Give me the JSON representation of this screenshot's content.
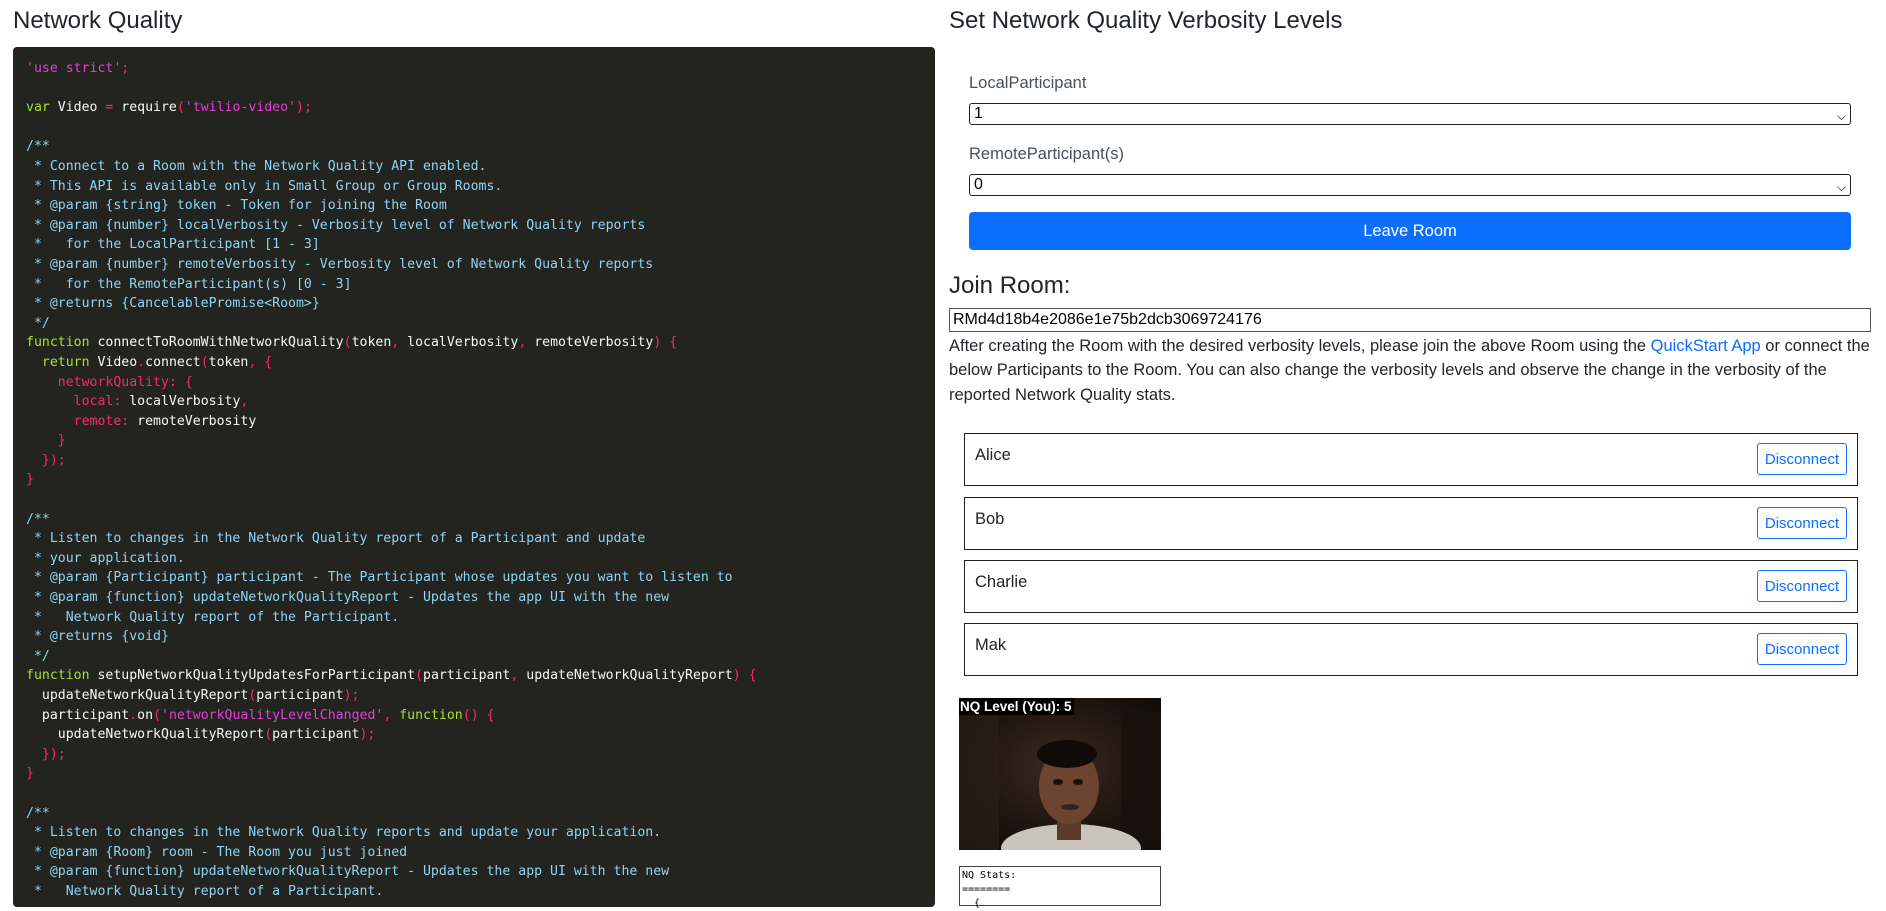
{
  "left": {
    "title": "Network Quality"
  },
  "code": {
    "lines": [
      [
        [
          "s",
          "'use strict'"
        ],
        [
          "p",
          ";"
        ]
      ],
      [],
      [
        [
          "k",
          "var"
        ],
        [
          "t",
          " Video "
        ],
        [
          "p",
          "="
        ],
        [
          "t",
          " require"
        ],
        [
          "p",
          "("
        ],
        [
          "s",
          "'twilio-video'"
        ],
        [
          "p",
          ");"
        ]
      ],
      [],
      [
        [
          "c",
          "/**"
        ]
      ],
      [
        [
          "c",
          " * Connect to a Room with the Network Quality API enabled."
        ]
      ],
      [
        [
          "c",
          " * This API is available only in Small Group or Group Rooms."
        ]
      ],
      [
        [
          "c",
          " * @param {string} token - Token for joining the Room"
        ]
      ],
      [
        [
          "c",
          " * @param {number} localVerbosity - Verbosity level of Network Quality reports"
        ]
      ],
      [
        [
          "c",
          " *   for the LocalParticipant [1 - 3]"
        ]
      ],
      [
        [
          "c",
          " * @param {number} remoteVerbosity - Verbosity level of Network Quality reports"
        ]
      ],
      [
        [
          "c",
          " *   for the RemoteParticipant(s) [0 - 3]"
        ]
      ],
      [
        [
          "c",
          " * @returns {CancelablePromise<Room>}"
        ]
      ],
      [
        [
          "c",
          " */"
        ]
      ],
      [
        [
          "k",
          "function"
        ],
        [
          "t",
          " connectToRoomWithNetworkQuality"
        ],
        [
          "p",
          "("
        ],
        [
          "t",
          "token"
        ],
        [
          "p",
          ","
        ],
        [
          "t",
          " localVerbosity"
        ],
        [
          "p",
          ","
        ],
        [
          "t",
          " remoteVerbosity"
        ],
        [
          "p",
          ")"
        ],
        [
          "t",
          " "
        ],
        [
          "p",
          "{"
        ]
      ],
      [
        [
          "t",
          "  "
        ],
        [
          "k",
          "return"
        ],
        [
          "t",
          " Video"
        ],
        [
          "p",
          "."
        ],
        [
          "t",
          "connect"
        ],
        [
          "p",
          "("
        ],
        [
          "t",
          "token"
        ],
        [
          "p",
          ","
        ],
        [
          "t",
          " "
        ],
        [
          "p",
          "{"
        ]
      ],
      [
        [
          "t",
          "    "
        ],
        [
          "r",
          "networkQuality"
        ],
        [
          "p",
          ":"
        ],
        [
          "t",
          " "
        ],
        [
          "p",
          "{"
        ]
      ],
      [
        [
          "t",
          "      "
        ],
        [
          "r",
          "local"
        ],
        [
          "p",
          ":"
        ],
        [
          "t",
          " localVerbosity"
        ],
        [
          "p",
          ","
        ]
      ],
      [
        [
          "t",
          "      "
        ],
        [
          "r",
          "remote"
        ],
        [
          "p",
          ":"
        ],
        [
          "t",
          " remoteVerbosity"
        ]
      ],
      [
        [
          "t",
          "    "
        ],
        [
          "p",
          "}"
        ]
      ],
      [
        [
          "t",
          "  "
        ],
        [
          "p",
          "});"
        ]
      ],
      [
        [
          "p",
          "}"
        ]
      ],
      [],
      [
        [
          "c",
          "/**"
        ]
      ],
      [
        [
          "c",
          " * Listen to changes in the Network Quality report of a Participant and update"
        ]
      ],
      [
        [
          "c",
          " * your application."
        ]
      ],
      [
        [
          "c",
          " * @param {Participant} participant - The Participant whose updates you want to listen to"
        ]
      ],
      [
        [
          "c",
          " * @param {function} updateNetworkQualityReport - Updates the app UI with the new"
        ]
      ],
      [
        [
          "c",
          " *   Network Quality report of the Participant."
        ]
      ],
      [
        [
          "c",
          " * @returns {void}"
        ]
      ],
      [
        [
          "c",
          " */"
        ]
      ],
      [
        [
          "k",
          "function"
        ],
        [
          "t",
          " setupNetworkQualityUpdatesForParticipant"
        ],
        [
          "p",
          "("
        ],
        [
          "t",
          "participant"
        ],
        [
          "p",
          ","
        ],
        [
          "t",
          " updateNetworkQualityReport"
        ],
        [
          "p",
          ")"
        ],
        [
          "t",
          " "
        ],
        [
          "p",
          "{"
        ]
      ],
      [
        [
          "t",
          "  updateNetworkQualityReport"
        ],
        [
          "p",
          "("
        ],
        [
          "t",
          "participant"
        ],
        [
          "p",
          ");"
        ]
      ],
      [
        [
          "t",
          "  participant"
        ],
        [
          "p",
          "."
        ],
        [
          "t",
          "on"
        ],
        [
          "p",
          "("
        ],
        [
          "s",
          "'networkQualityLevelChanged'"
        ],
        [
          "p",
          ","
        ],
        [
          "t",
          " "
        ],
        [
          "k",
          "function"
        ],
        [
          "p",
          "()"
        ],
        [
          "t",
          " "
        ],
        [
          "p",
          "{"
        ]
      ],
      [
        [
          "t",
          "    updateNetworkQualityReport"
        ],
        [
          "p",
          "("
        ],
        [
          "t",
          "participant"
        ],
        [
          "p",
          ");"
        ]
      ],
      [
        [
          "t",
          "  "
        ],
        [
          "p",
          "});"
        ]
      ],
      [
        [
          "p",
          "}"
        ]
      ],
      [],
      [
        [
          "c",
          "/**"
        ]
      ],
      [
        [
          "c",
          " * Listen to changes in the Network Quality reports and update your application."
        ]
      ],
      [
        [
          "c",
          " * @param {Room} room - The Room you just joined"
        ]
      ],
      [
        [
          "c",
          " * @param {function} updateNetworkQualityReport - Updates the app UI with the new"
        ]
      ],
      [
        [
          "c",
          " *   Network Quality report of a Participant."
        ]
      ]
    ]
  },
  "right": {
    "title": "Set Network Quality Verbosity Levels",
    "local_label": "LocalParticipant",
    "local_value": "1",
    "remote_label": "RemoteParticipant(s)",
    "remote_value": "0",
    "leave_label": "Leave Room",
    "join_title": "Join Room:",
    "room_sid": "RMd4d18b4e2086e1e75b2dcb3069724176",
    "desc_before": "After creating the Room with the desired verbosity levels, please join the above Room using the ",
    "desc_link": "QuickStart App",
    "desc_after": " or connect the below Participants to the Room. You can also change the verbosity levels and observe the change in the verbosity of the reported Network Quality stats.",
    "participants": [
      {
        "name": "Alice",
        "button": "Disconnect"
      },
      {
        "name": "Bob",
        "button": "Disconnect"
      },
      {
        "name": "Charlie",
        "button": "Disconnect"
      },
      {
        "name": "Mak",
        "button": "Disconnect"
      }
    ],
    "video_label": "NQ Level (You): 5",
    "stats_text": "NQ Stats:\n========\n  {"
  },
  "colors": {
    "accent": "#0b6efd",
    "code_bg": "#23241f",
    "code_comment": "#8ed3f2",
    "code_string": "#e23fd6",
    "code_keyword": "#a6e22e",
    "code_punct": "#f92672"
  }
}
